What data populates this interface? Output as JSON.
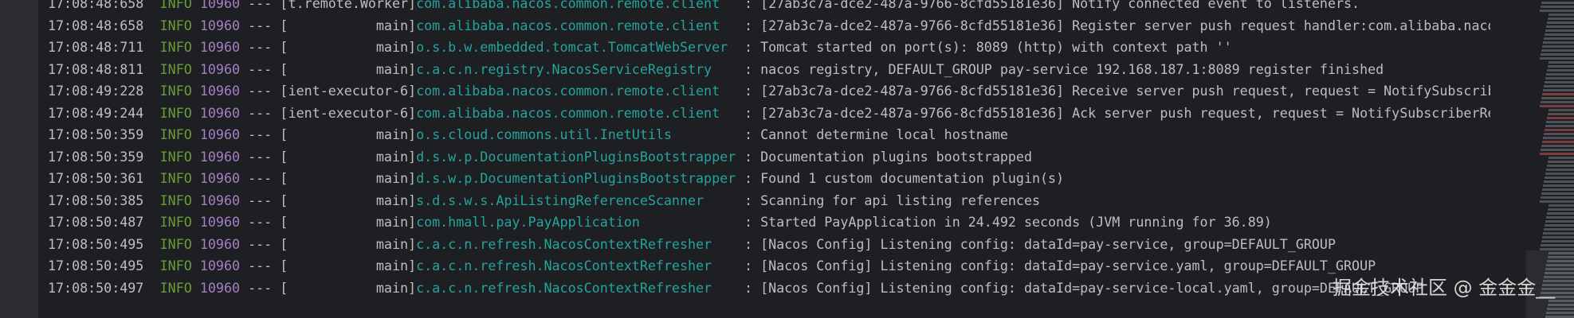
{
  "console": {
    "rows": [
      {
        "time": "17:08:48:658",
        "level": "INFO",
        "pid": "10960",
        "sep": "---",
        "thread": "t.remote.Worker",
        "logger": "com.alibaba.nacos.common.remote.client",
        "message": "[27ab3c7a-dce2-487a-9766-8cfd55181e36] Notify connected event to listeners."
      },
      {
        "time": "17:08:48:658",
        "level": "INFO",
        "pid": "10960",
        "sep": "---",
        "thread": "main",
        "logger": "com.alibaba.nacos.common.remote.client",
        "message": "[27ab3c7a-dce2-487a-9766-8cfd55181e36] Register server push request handler:com.alibaba.nacos.co"
      },
      {
        "time": "17:08:48:711",
        "level": "INFO",
        "pid": "10960",
        "sep": "---",
        "thread": "main",
        "logger": "o.s.b.w.embedded.tomcat.TomcatWebServer",
        "message": "Tomcat started on port(s): 8089 (http) with context path ''"
      },
      {
        "time": "17:08:48:811",
        "level": "INFO",
        "pid": "10960",
        "sep": "---",
        "thread": "main",
        "logger": "c.a.c.n.registry.NacosServiceRegistry",
        "message": "nacos registry, DEFAULT_GROUP pay-service 192.168.187.1:8089 register finished"
      },
      {
        "time": "17:08:49:228",
        "level": "INFO",
        "pid": "10960",
        "sep": "---",
        "thread": "ient-executor-6",
        "logger": "com.alibaba.nacos.common.remote.client",
        "message": "[27ab3c7a-dce2-487a-9766-8cfd55181e36] Receive server push request, request = NotifySubscriberRe"
      },
      {
        "time": "17:08:49:244",
        "level": "INFO",
        "pid": "10960",
        "sep": "---",
        "thread": "ient-executor-6",
        "logger": "com.alibaba.nacos.common.remote.client",
        "message": "[27ab3c7a-dce2-487a-9766-8cfd55181e36] Ack server push request, request = NotifySubscriberReques"
      },
      {
        "time": "17:08:50:359",
        "level": "INFO",
        "pid": "10960",
        "sep": "---",
        "thread": "main",
        "logger": "o.s.cloud.commons.util.InetUtils",
        "message": "Cannot determine local hostname"
      },
      {
        "time": "17:08:50:359",
        "level": "INFO",
        "pid": "10960",
        "sep": "---",
        "thread": "main",
        "logger": "d.s.w.p.DocumentationPluginsBootstrapper",
        "message": "Documentation plugins bootstrapped"
      },
      {
        "time": "17:08:50:361",
        "level": "INFO",
        "pid": "10960",
        "sep": "---",
        "thread": "main",
        "logger": "d.s.w.p.DocumentationPluginsBootstrapper",
        "message": "Found 1 custom documentation plugin(s)"
      },
      {
        "time": "17:08:50:385",
        "level": "INFO",
        "pid": "10960",
        "sep": "---",
        "thread": "main",
        "logger": "s.d.s.w.s.ApiListingReferenceScanner",
        "message": "Scanning for api listing references"
      },
      {
        "time": "17:08:50:487",
        "level": "INFO",
        "pid": "10960",
        "sep": "---",
        "thread": "main",
        "logger": "com.hmall.pay.PayApplication",
        "message": "Started PayApplication in 24.492 seconds (JVM running for 36.89)"
      },
      {
        "time": "17:08:50:495",
        "level": "INFO",
        "pid": "10960",
        "sep": "---",
        "thread": "main",
        "logger": "c.a.c.n.refresh.NacosContextRefresher",
        "message": "[Nacos Config] Listening config: dataId=pay-service, group=DEFAULT_GROUP"
      },
      {
        "time": "17:08:50:495",
        "level": "INFO",
        "pid": "10960",
        "sep": "---",
        "thread": "main",
        "logger": "c.a.c.n.refresh.NacosContextRefresher",
        "message": "[Nacos Config] Listening config: dataId=pay-service.yaml, group=DEFAULT_GROUP"
      },
      {
        "time": "17:08:50:497",
        "level": "INFO",
        "pid": "10960",
        "sep": "---",
        "thread": "main",
        "logger": "c.a.c.n.refresh.NacosContextRefresher",
        "message": "[Nacos Config] Listening config: dataId=pay-service-local.yaml, group=DEFAULT_GROUP"
      }
    ]
  },
  "watermark": "掘金技术社区 @ 金金金__",
  "colors": {
    "background": "#1e1f22",
    "gutter": "#2b2d30",
    "level_info": "#6a9b3a",
    "pid": "#a47fc4",
    "logger": "#25a39d",
    "text": "#bcbec4"
  }
}
